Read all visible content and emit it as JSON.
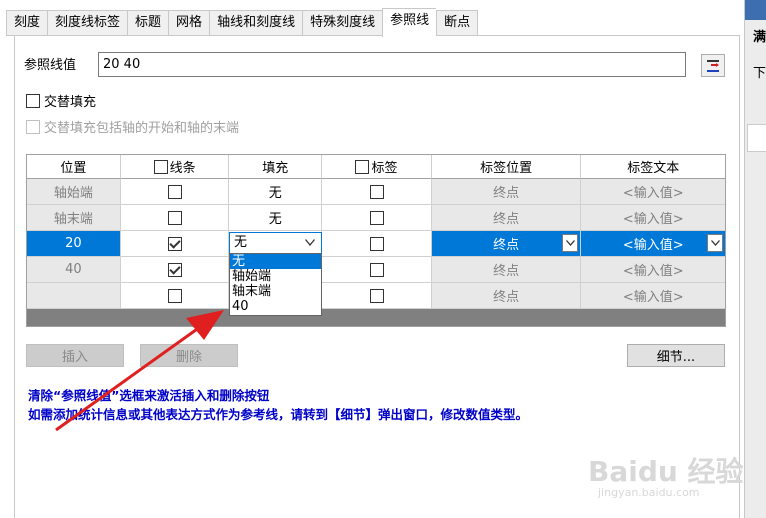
{
  "tabs": [
    "刻度",
    "刻度线标签",
    "标题",
    "网格",
    "轴线和刻度线",
    "特殊刻度线",
    "参照线",
    "断点"
  ],
  "active_tab": "参照线",
  "right_panel": {
    "line1": "满",
    "line2": "下"
  },
  "reference": {
    "label": "参照线值",
    "value": "20  40"
  },
  "options": {
    "alt_fill": "交替填充",
    "alt_fill_axis": "交替填充包括轴的开始和轴的末端"
  },
  "grid": {
    "headers": [
      "位置",
      "线条",
      "填充",
      "标签",
      "标签位置",
      "标签文本"
    ],
    "rows": [
      {
        "pos": "轴始端",
        "fill": "无",
        "label_pos": "终点",
        "label_text": "<输入值>"
      },
      {
        "pos": "轴末端",
        "fill": "无",
        "label_pos": "终点",
        "label_text": "<输入值>"
      },
      {
        "pos": "20",
        "fill": "",
        "label_pos": "终点",
        "label_text": "<输入值>"
      },
      {
        "pos": "40",
        "fill": "",
        "label_pos": "终点",
        "label_text": "<输入值>"
      },
      {
        "pos": "",
        "fill": "",
        "label_pos": "终点",
        "label_text": "<输入值>"
      }
    ]
  },
  "fill_combo": {
    "value": "无",
    "options": [
      "无",
      "轴始端",
      "轴末端",
      "40"
    ]
  },
  "buttons": {
    "insert": "插入",
    "delete": "删除",
    "details": "细节..."
  },
  "notes": {
    "line1": "清除“参照线值”选框来激活插入和删除按钮",
    "line2": "如需添加统计信息或其他表达方式作为参考线，请转到【细节】弹出窗口，修改数值类型。"
  },
  "watermark": {
    "main": "Baidu 经验",
    "sub": "jingyan.baidu.com"
  },
  "colors": {
    "selection": "#0078d7",
    "note_text": "#0000c8",
    "arrow": "#e02020"
  }
}
